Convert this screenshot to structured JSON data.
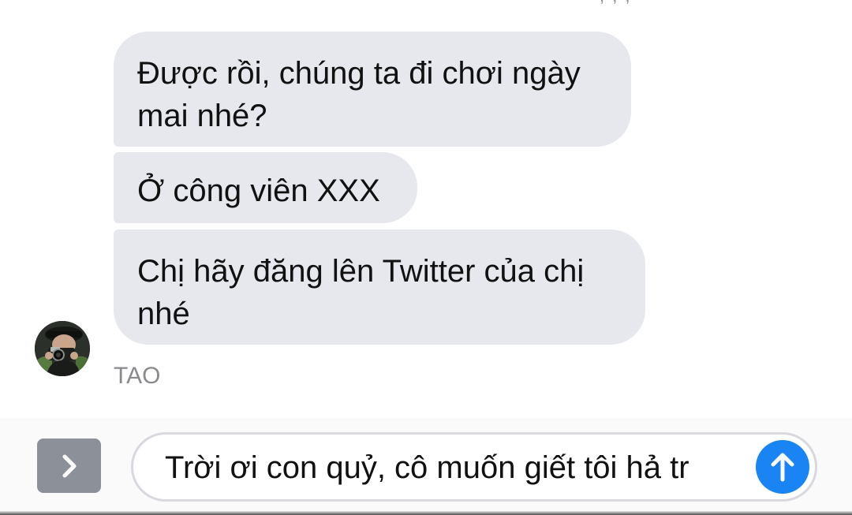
{
  "conversation": {
    "messages": [
      {
        "text": "Được rồi, chúng ta đi chơi ngày\nmai nhé?"
      },
      {
        "text": "Ở công viên XXX"
      },
      {
        "text": "Chị hãy đăng lên Twitter của chị\nnhé"
      }
    ],
    "sender": {
      "name": "TAO",
      "avatar_icon": "person-with-camera-avatar"
    }
  },
  "composer": {
    "expand_icon": "chevron-right-icon",
    "input_value": "Trời ơi con quỷ, cô muốn giết tôi hả tr",
    "send_icon": "arrow-up-icon",
    "send_color": "#1a84f5"
  },
  "colors": {
    "bubble_background": "#e6e8ee",
    "expand_button": "#8c9099"
  }
}
